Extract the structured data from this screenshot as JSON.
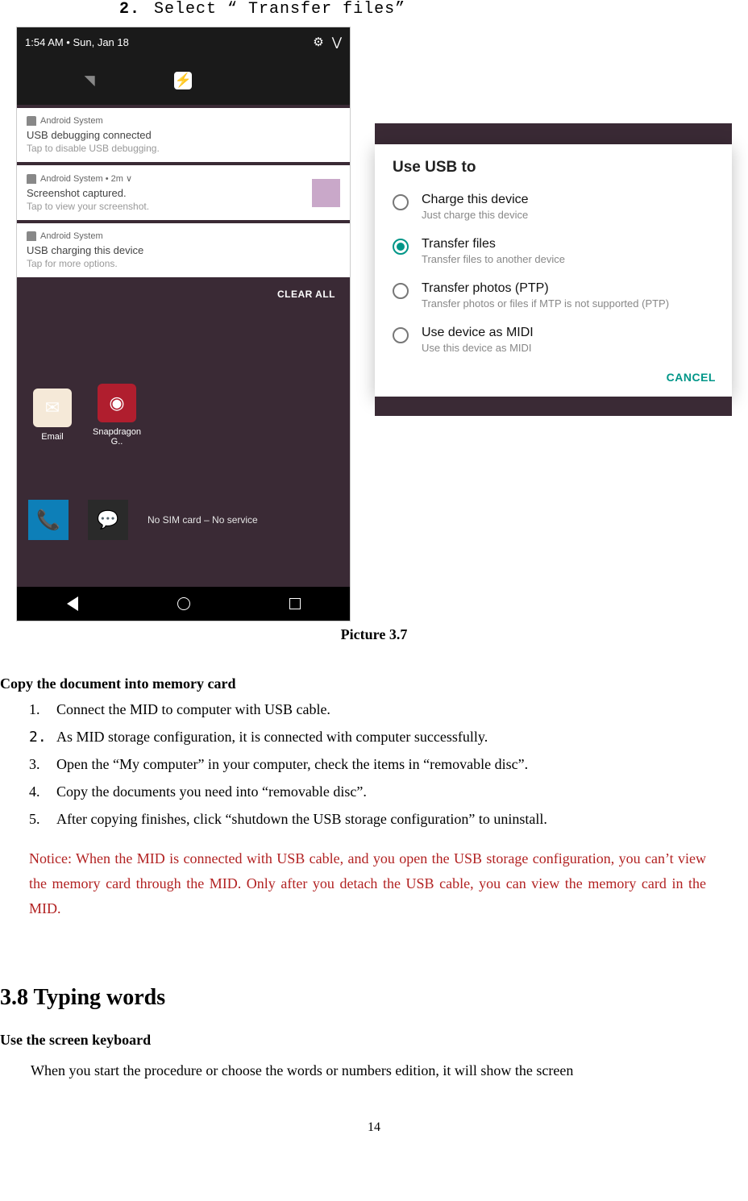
{
  "top_step": {
    "number": "2.",
    "text": "Select “ Transfer files”"
  },
  "phone_left": {
    "time": "1:54 AM • Sun, Jan 18",
    "notifs": [
      {
        "hdr": "Android System",
        "title": "USB debugging connected",
        "sub": "Tap to disable USB debugging."
      },
      {
        "hdr": "Android System • 2m ∨",
        "title": "Screenshot captured.",
        "sub": "Tap to view your screenshot."
      },
      {
        "hdr": "Android System",
        "title": "USB charging this device",
        "sub": "Tap for more options."
      }
    ],
    "clear_all": "CLEAR ALL",
    "apps": {
      "email": "Email",
      "snap": "Snapdragon G.."
    },
    "sim_msg": "No SIM card – No service"
  },
  "dialog": {
    "title": "Use USB to",
    "options": [
      {
        "label": "Charge this device",
        "sub": "Just charge this device",
        "selected": false
      },
      {
        "label": "Transfer files",
        "sub": "Transfer files to another device",
        "selected": true
      },
      {
        "label": "Transfer photos (PTP)",
        "sub": "Transfer photos or files if MTP is not supported (PTP)",
        "selected": false
      },
      {
        "label": "Use device as MIDI",
        "sub": "Use this device as MIDI",
        "selected": false
      }
    ],
    "cancel": "CANCEL"
  },
  "caption": "Picture 3.7",
  "section": {
    "title": "Copy the document into memory card",
    "items": [
      "Connect the MID to computer with USB cable.",
      "As MID storage configuration, it is connected with computer successfully.",
      "Open the “My computer” in your computer, check the items in “removable disc”.",
      "Copy the documents you need into “removable disc”.",
      "After copying finishes, click “shutdown the USB storage configuration” to uninstall."
    ],
    "notice": "Notice: When the MID is connected with USB cable, and you open the USB storage configuration, you can’t view the memory card through the MID. Only after you detach the USB cable, you can view the memory card in the MID."
  },
  "heading38": "3.8 Typing words",
  "sub_bold": "Use the screen keyboard",
  "para": "When you start the procedure or choose the words or numbers edition, it will show the screen",
  "page_number": "14"
}
